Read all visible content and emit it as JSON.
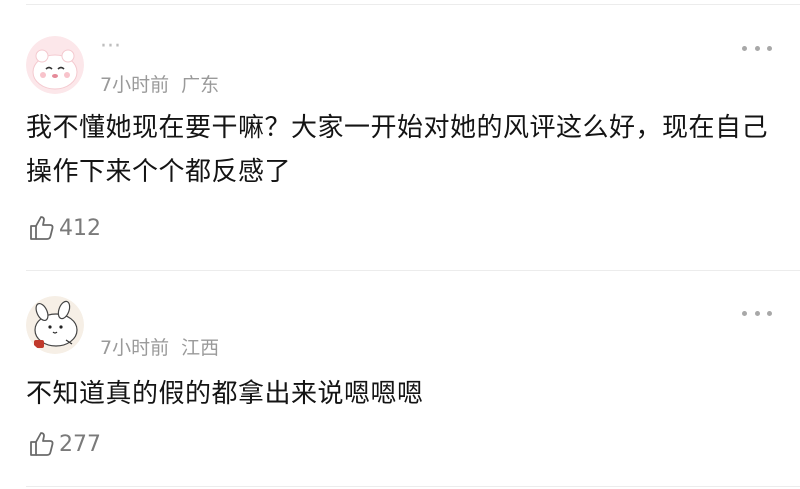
{
  "comments": [
    {
      "username": "···",
      "time": "7小时前",
      "location": "广东",
      "text": "我不懂她现在要干嘛？大家一开始对她的风评这么好，现在自己操作下来个个都反感了",
      "likes": "412",
      "avatar_icon": "pink-bear-avatar",
      "like_icon": "thumbs-up-outline-icon",
      "more_icon": "more-dots-icon"
    },
    {
      "time": "7小时前",
      "location": "江西",
      "text": "不知道真的假的都拿出来说嗯嗯嗯",
      "likes": "277",
      "avatar_icon": "white-bunny-avatar",
      "like_icon": "thumbs-up-outline-icon",
      "more_icon": "more-dots-icon"
    }
  ],
  "colors": {
    "meta_text": "#9a9a9a",
    "body_text": "#141414",
    "divider": "#ececec",
    "avatar_pink": "#fbe3e6"
  }
}
